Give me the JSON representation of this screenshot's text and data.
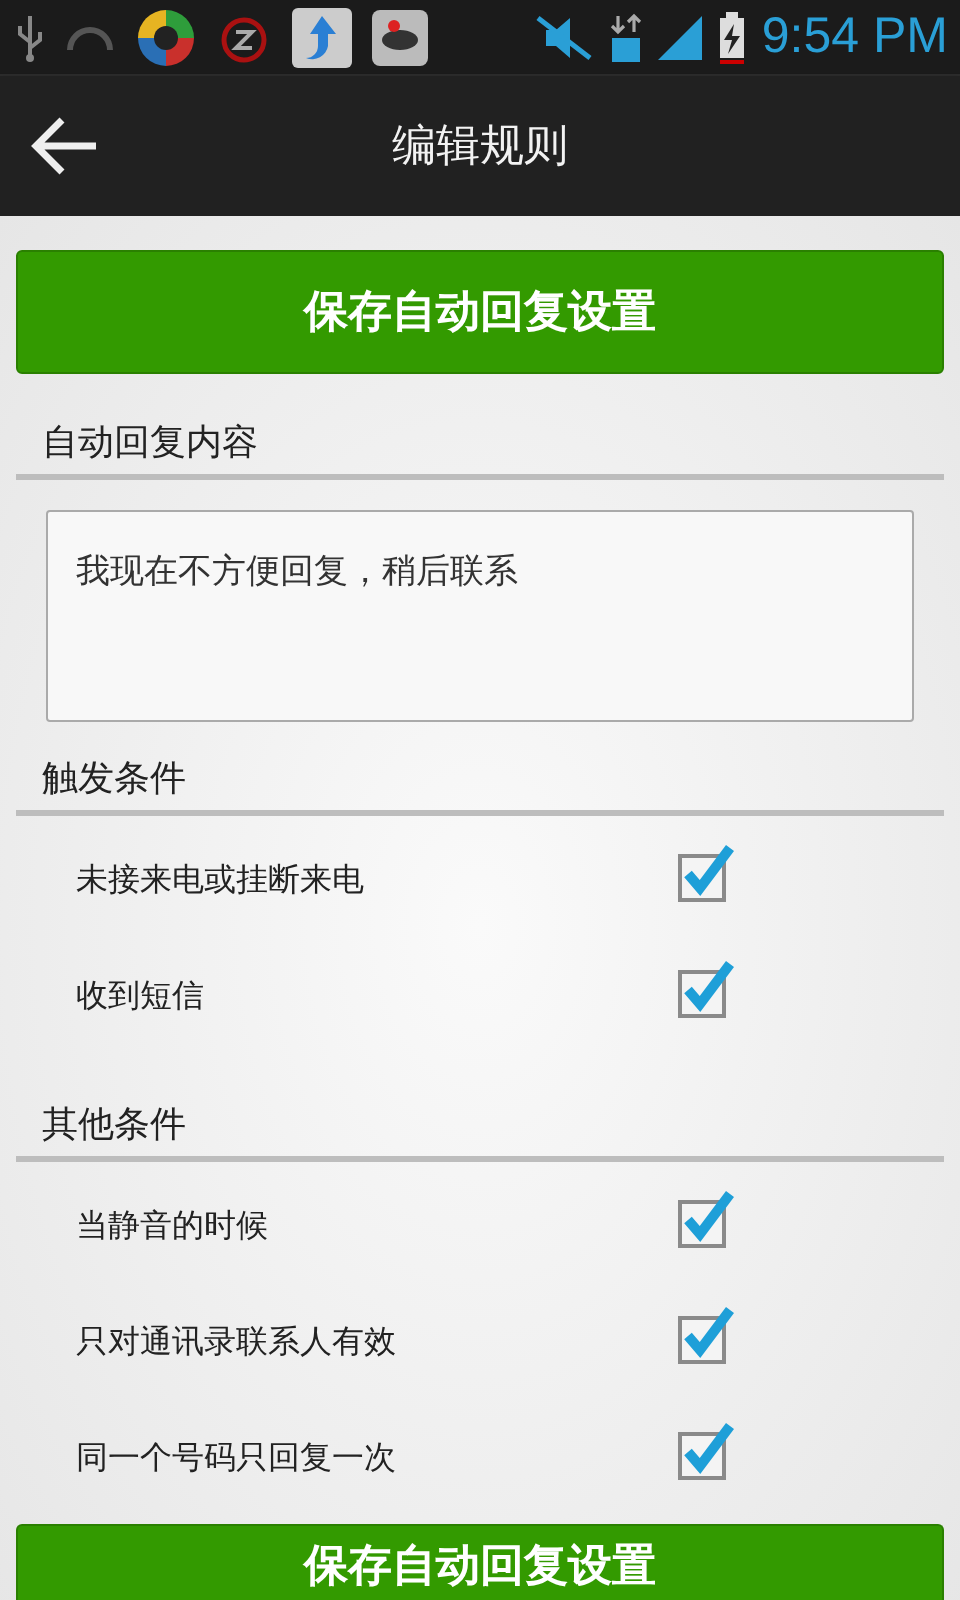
{
  "status_bar": {
    "time": "9:54 PM"
  },
  "app_bar": {
    "title": "编辑规则"
  },
  "save_button_top": "保存自动回复设置",
  "reply_section": {
    "title": "自动回复内容",
    "value": "我现在不方便回复，稍后联系"
  },
  "sections": [
    {
      "title": "触发条件",
      "options": [
        {
          "label": "未接来电或挂断来电",
          "checked": true
        },
        {
          "label": "收到短信",
          "checked": true
        }
      ]
    },
    {
      "title": "其他条件",
      "options": [
        {
          "label": "当静音的时候",
          "checked": true
        },
        {
          "label": "只对通讯录联系人有效",
          "checked": true
        },
        {
          "label": "同一个号码只回复一次",
          "checked": true
        }
      ]
    }
  ],
  "save_button_bottom": "保存自动回复设置"
}
